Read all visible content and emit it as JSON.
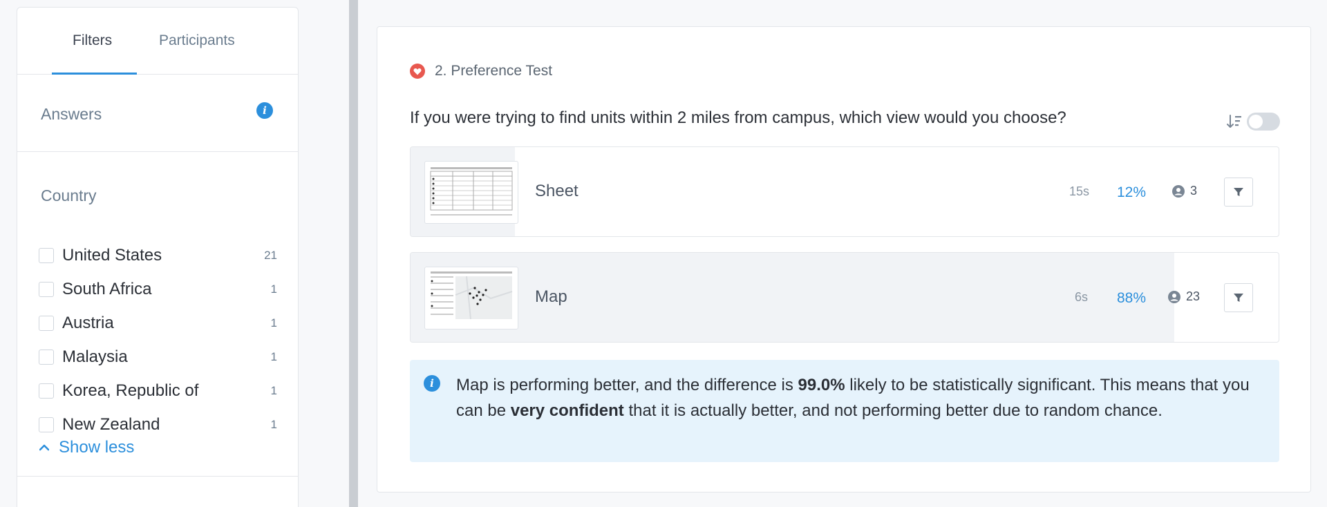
{
  "sidebar": {
    "tabs": [
      {
        "label": "Filters",
        "active": true
      },
      {
        "label": "Participants",
        "active": false
      }
    ],
    "answers_label": "Answers",
    "country_label": "Country",
    "countries": [
      {
        "name": "United States",
        "count": "21"
      },
      {
        "name": "South Africa",
        "count": "1"
      },
      {
        "name": "Austria",
        "count": "1"
      },
      {
        "name": "Malaysia",
        "count": "1"
      },
      {
        "name": "Korea, Republic of",
        "count": "1"
      },
      {
        "name": "New Zealand",
        "count": "1"
      }
    ],
    "show_less_label": "Show less"
  },
  "main": {
    "test_title": "2. Preference Test",
    "question": "If you were trying to find units within 2 miles from campus, which view would you choose?",
    "options": [
      {
        "name": "Sheet",
        "time": "15s",
        "percent": "12%",
        "participants": "3",
        "share": 0.12
      },
      {
        "name": "Map",
        "time": "6s",
        "percent": "88%",
        "participants": "23",
        "share": 0.88
      }
    ],
    "notice": {
      "part1": "Map is performing better, and the difference is ",
      "bold1": "99.0%",
      "part2": " likely to be statistically significant. This means that you can be ",
      "bold2": "very confident",
      "part3": " that it is actually better, and not performing better due to random chance."
    }
  },
  "colors": {
    "accent": "#2c8fdc",
    "heart": "#e8584f",
    "notice_bg": "#e6f3fc"
  }
}
